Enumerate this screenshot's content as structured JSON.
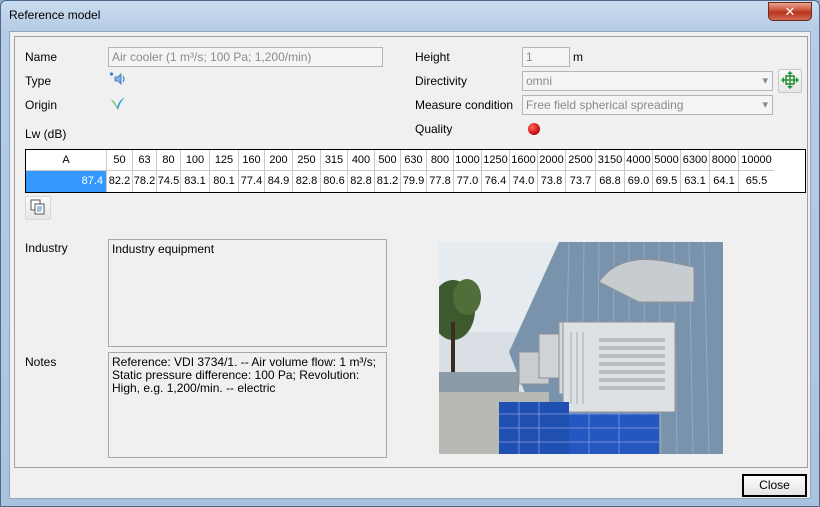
{
  "window": {
    "title": "Reference model",
    "close_glyph": "✕"
  },
  "form": {
    "name_label": "Name",
    "name_value": "Air cooler (1 m³/s; 100 Pa; 1,200/min)",
    "type_label": "Type",
    "origin_label": "Origin",
    "lw_label": "Lw (dB)",
    "height_label": "Height",
    "height_value": "1",
    "height_unit": "m",
    "directivity_label": "Directivity",
    "directivity_value": "omni",
    "measure_label": "Measure condition",
    "measure_value": "Free field spherical spreading",
    "quality_label": "Quality",
    "quality_color": "#cc1111"
  },
  "spectrum": {
    "headers": [
      "A",
      "50",
      "63",
      "80",
      "100",
      "125",
      "160",
      "200",
      "250",
      "315",
      "400",
      "500",
      "630",
      "800",
      "1000",
      "1250",
      "1600",
      "2000",
      "2500",
      "3150",
      "4000",
      "5000",
      "6300",
      "8000",
      "10000"
    ],
    "values": [
      "87.4",
      "82.2",
      "78.2",
      "74.5",
      "83.1",
      "80.1",
      "77.4",
      "84.9",
      "82.8",
      "80.6",
      "82.8",
      "81.2",
      "79.9",
      "77.8",
      "77.0",
      "76.4",
      "74.0",
      "73.8",
      "73.7",
      "68.8",
      "69.0",
      "69.5",
      "63.1",
      "64.1",
      "65.5"
    ]
  },
  "industry": {
    "label": "Industry",
    "text": "Industry equipment"
  },
  "notes": {
    "label": "Notes",
    "text": "Reference: VDI 3734/1. -- Air volume flow: 1 m³/s; Static pressure difference: 100 Pa; Revolution: High, e.g. 1,200/min. -- electric"
  },
  "buttons": {
    "close_label": "Close"
  },
  "icons": {
    "type": "speaker-icon",
    "origin": "checkmark-icon",
    "directivity_edit": "move-arrows-icon",
    "copy": "copy-icon"
  }
}
